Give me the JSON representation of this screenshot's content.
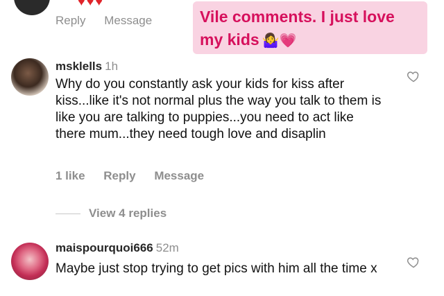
{
  "top_comment": {
    "reply_label": "Reply",
    "message_label": "Message"
  },
  "annotation": {
    "text_line1": "Vile comments. I just love",
    "text_line2": "my kids",
    "emoji": "🤷‍♀️💗"
  },
  "comments": [
    {
      "username": "msklells",
      "time": "1h",
      "text": "Why do you constantly ask your kids for kiss after kiss...like it's not normal plus the way you talk to them is like you are talking to puppies...you need to act like there mum...they need tough love and disaplin",
      "likes": "1 like",
      "reply_label": "Reply",
      "message_label": "Message",
      "view_replies": "View 4 replies"
    },
    {
      "username": "maispourquoi666",
      "time": "52m",
      "text": "Maybe just stop trying to get pics with him all the time x"
    }
  ],
  "colors": {
    "annotation_bg": "#f9d3e2",
    "annotation_text": "#d6105c",
    "muted": "#8e8e8e"
  }
}
